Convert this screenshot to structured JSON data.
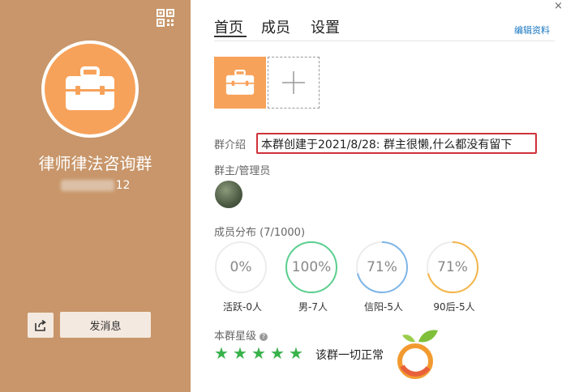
{
  "left_panel": {
    "group_name": "律师律法咨询群",
    "group_id_visible": "12",
    "send_message_label": "发消息",
    "background_color": "#c8966a"
  },
  "window": {
    "close_glyph": "×"
  },
  "tabs": [
    {
      "label": "首页",
      "active": true
    },
    {
      "label": "成员",
      "active": false
    },
    {
      "label": "设置",
      "active": false
    }
  ],
  "edit_profile_label": "编辑资料",
  "intro": {
    "label": "群介绍",
    "text": "本群创建于2021/8/28:  群主很懒,什么都没有留下"
  },
  "admins": {
    "label": "群主/管理员"
  },
  "distribution": {
    "label": "成员分布 (7/1000)",
    "items": [
      {
        "percent": "0%",
        "label": "活跃-0人",
        "value": 0,
        "color": "#e9e9e9"
      },
      {
        "percent": "100%",
        "label": "男-7人",
        "value": 1.0,
        "color": "#5ccf8f"
      },
      {
        "percent": "71%",
        "label": "信阳-5人",
        "value": 0.71,
        "color": "#7fb6e8"
      },
      {
        "percent": "71%",
        "label": "90后-5人",
        "value": 0.71,
        "color": "#f3b54a"
      }
    ]
  },
  "rating": {
    "label": "本群星级",
    "stars": 5,
    "status_text": "该群一切正常",
    "star_color": "#38b24b"
  },
  "icons": {
    "qr": "qr-code-icon",
    "briefcase": "briefcase-icon",
    "share": "share-icon",
    "add": "plus-icon",
    "help": "help-icon",
    "logo": "orange-fruit-logo"
  }
}
